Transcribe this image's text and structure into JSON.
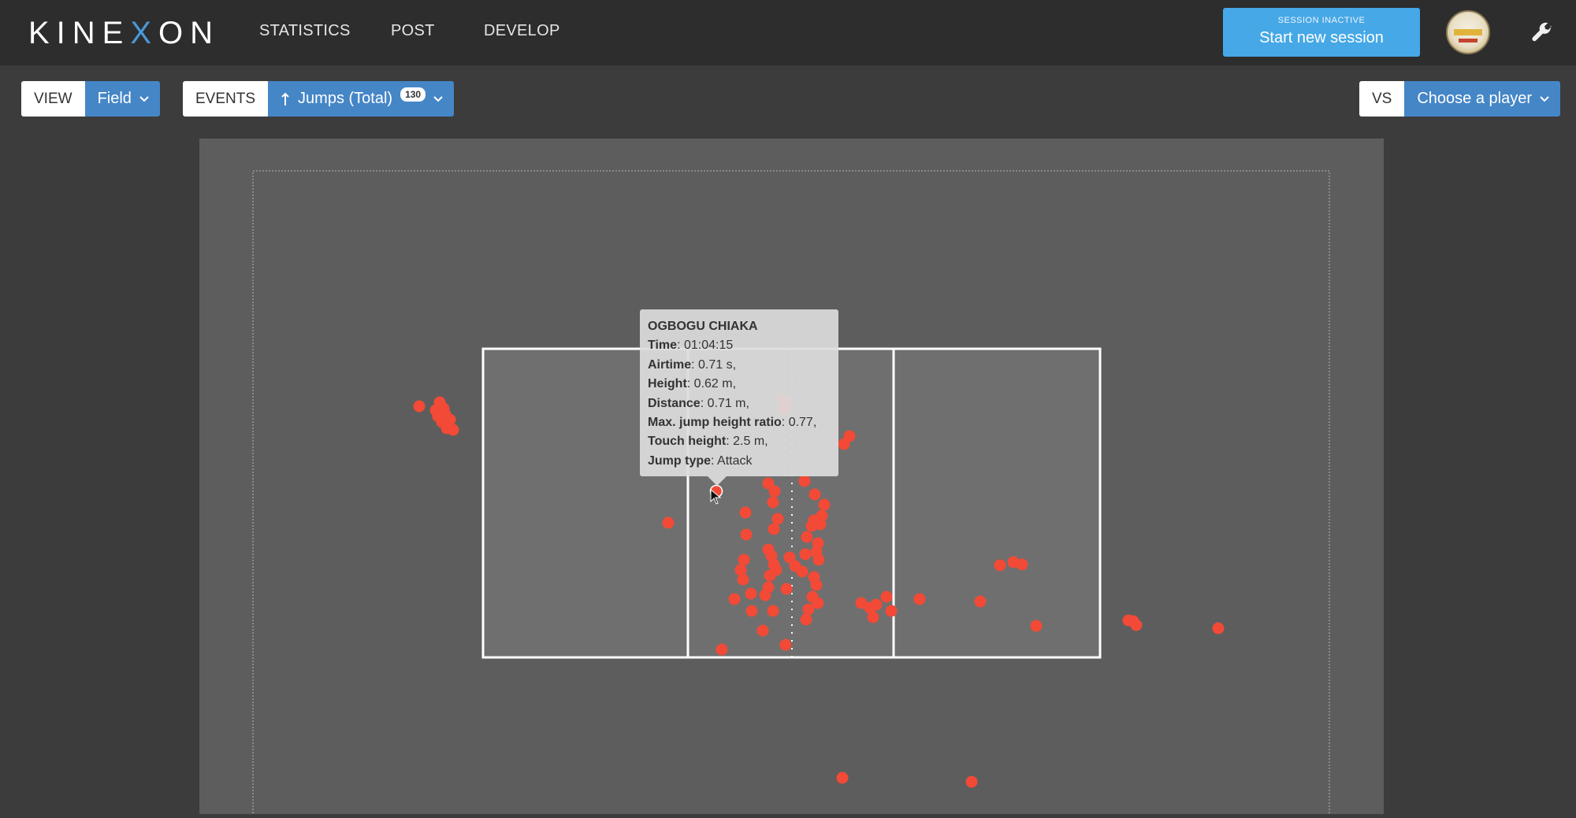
{
  "brand": {
    "logo_prefix": "KINE",
    "logo_x": "X",
    "logo_suffix": "ON"
  },
  "nav": [
    {
      "label": "STATISTICS"
    },
    {
      "label": "POST"
    },
    {
      "label": "DEVELOP"
    }
  ],
  "session": {
    "status": "SESSION INACTIVE",
    "action_label": "Start new session"
  },
  "toolbar": {
    "view_label": "VIEW",
    "view_value": "Field",
    "events_label": "EVENTS",
    "events_value": "Jumps (Total)",
    "events_count": "130",
    "vs_label": "VS",
    "vs_value": "Choose a player"
  },
  "tooltip": {
    "player": "OGBOGU CHIAKA",
    "rows": [
      {
        "key": "Time",
        "value": "01:04:15"
      },
      {
        "key": "Airtime",
        "value": "0.71 s,"
      },
      {
        "key": "Height",
        "value": "0.62 m,"
      },
      {
        "key": "Distance",
        "value": "0.71 m,"
      },
      {
        "key": "Max. jump height ratio",
        "value": "0.77,"
      },
      {
        "key": "Touch height",
        "value": "2.5 m,"
      },
      {
        "key": "Jump type",
        "value": "Attack"
      }
    ]
  },
  "colors": {
    "accent": "#4586c7",
    "session_button": "#46a8e6",
    "jump_marker": "#f24a36",
    "field_background": "#5d5d5d",
    "court_background": "#6f6f6f"
  },
  "icons": {
    "wrench": "wrench-icon",
    "dropdown": "chevron-down-icon",
    "events": "arrow-up-icon"
  }
}
